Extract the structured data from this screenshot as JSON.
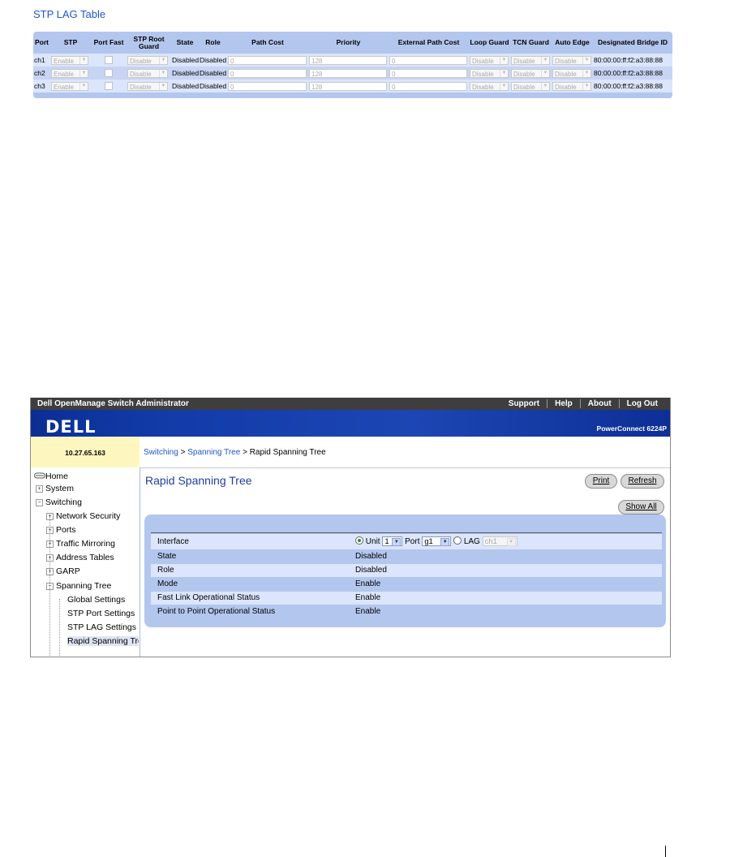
{
  "lag_table": {
    "title": "STP LAG Table",
    "headers": [
      "Port",
      "STP",
      "Port Fast",
      "STP Root Guard",
      "State",
      "Role",
      "Path Cost",
      "Priority",
      "External Path Cost",
      "Loop Guard",
      "TCN Guard",
      "Auto Edge",
      "Designated Bridge ID"
    ],
    "rows": [
      {
        "port": "ch1",
        "stp": "Enable",
        "root_guard": "Disable",
        "state": "Disabled",
        "role": "Disabled",
        "path_cost": "0",
        "priority": "128",
        "ext_path_cost": "0",
        "loop_guard": "Disable",
        "tcn_guard": "Disable",
        "auto_edge": "Disable",
        "bridge_id": "80:00:00:ff:f2:a3:88:88"
      },
      {
        "port": "ch2",
        "stp": "Enable",
        "root_guard": "Disable",
        "state": "Disabled",
        "role": "Disabled",
        "path_cost": "0",
        "priority": "128",
        "ext_path_cost": "0",
        "loop_guard": "Disable",
        "tcn_guard": "Disable",
        "auto_edge": "Disable",
        "bridge_id": "80:00:00:ff:f2:a3:88:88"
      },
      {
        "port": "ch3",
        "stp": "Enable",
        "root_guard": "Disable",
        "state": "Disabled",
        "role": "Disabled",
        "path_cost": "0",
        "priority": "128",
        "ext_path_cost": "0",
        "loop_guard": "Disable",
        "tcn_guard": "Disable",
        "auto_edge": "Disable",
        "bridge_id": "80:00:00:ff:f2:a3:88:88"
      }
    ]
  },
  "app": {
    "title": "Dell OpenManage Switch Administrator",
    "nav": [
      "Support",
      "Help",
      "About",
      "Log Out"
    ],
    "logo": "DELL",
    "model": "PowerConnect 6224P",
    "ip": "10.27.65.163",
    "breadcrumb": {
      "part1": "Switching",
      "sep1": ">",
      "part2": "Spanning Tree",
      "sep2": ">",
      "current": "Rapid Spanning Tree"
    }
  },
  "sidebar": {
    "items": [
      {
        "label": "Home"
      },
      {
        "label": "System"
      },
      {
        "label": "Switching"
      },
      {
        "label": "Network Security"
      },
      {
        "label": "Ports"
      },
      {
        "label": "Traffic Mirroring"
      },
      {
        "label": "Address Tables"
      },
      {
        "label": "GARP"
      },
      {
        "label": "Spanning Tree"
      },
      {
        "label": "Global Settings"
      },
      {
        "label": "STP Port Settings"
      },
      {
        "label": "STP LAG Settings"
      },
      {
        "label": "Rapid Spanning Tree"
      }
    ]
  },
  "main": {
    "title": "Rapid Spanning Tree",
    "print_label": "Print",
    "refresh_label": "Refresh",
    "show_all_label": "Show All",
    "interface": {
      "label": "Interface",
      "unit_label": "Unit",
      "unit_value": "1",
      "port_label": "Port",
      "port_value": "g1",
      "lag_label": "LAG",
      "lag_value": "ch1"
    },
    "fields": [
      {
        "label": "State",
        "value": "Disabled"
      },
      {
        "label": "Role",
        "value": "Disabled"
      },
      {
        "label": "Mode",
        "value": "Enable"
      },
      {
        "label": "Fast Link Operational Status",
        "value": "Enable"
      },
      {
        "label": "Point to Point Operational Status",
        "value": "Enable"
      }
    ]
  }
}
